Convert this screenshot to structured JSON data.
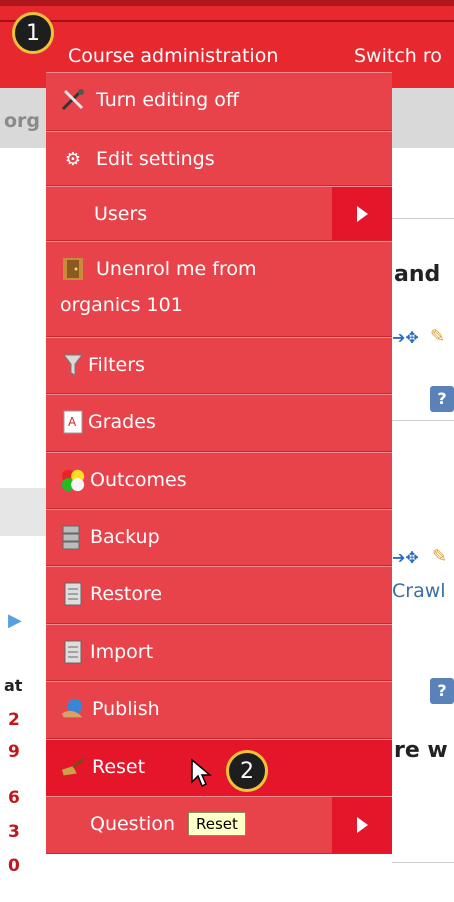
{
  "header": {
    "course_admin_label": "Course administration",
    "switch_role_label": "Switch ro"
  },
  "background": {
    "left_crumb": "org",
    "heading_right_1": "and",
    "link_right": "Crawl",
    "heading_right_2": "re w",
    "left_col_label": "at",
    "left_col_numbers": [
      "2",
      "9",
      "6",
      "3",
      "0"
    ],
    "help_label": "?"
  },
  "menu": {
    "items": [
      {
        "label": "Turn editing off",
        "icon": "tools-icon"
      },
      {
        "label": "Edit settings",
        "icon": "gear-icon"
      },
      {
        "label": "Users",
        "icon": "",
        "has_submenu": true
      },
      {
        "label_line1": "Unenrol me from",
        "label_line2": "organics 101",
        "icon": "door-icon"
      },
      {
        "label": "Filters",
        "icon": "filter-icon"
      },
      {
        "label": "Grades",
        "icon": "grades-icon"
      },
      {
        "label": "Outcomes",
        "icon": "outcomes-icon"
      },
      {
        "label": "Backup",
        "icon": "backup-icon"
      },
      {
        "label": "Restore",
        "icon": "restore-icon"
      },
      {
        "label": "Import",
        "icon": "import-icon"
      },
      {
        "label": "Publish",
        "icon": "publish-icon"
      },
      {
        "label": "Reset",
        "icon": "broom-icon",
        "selected": true
      },
      {
        "label": "Question",
        "icon": "",
        "has_submenu": true
      }
    ]
  },
  "tooltip": {
    "text": "Reset"
  },
  "callouts": {
    "first": "1",
    "second": "2"
  },
  "colors": {
    "menu_bg": "#e8434a",
    "selected_bg": "#e5162a",
    "header_bg": "#e8282f",
    "callout_ring": "#f0c23a"
  }
}
